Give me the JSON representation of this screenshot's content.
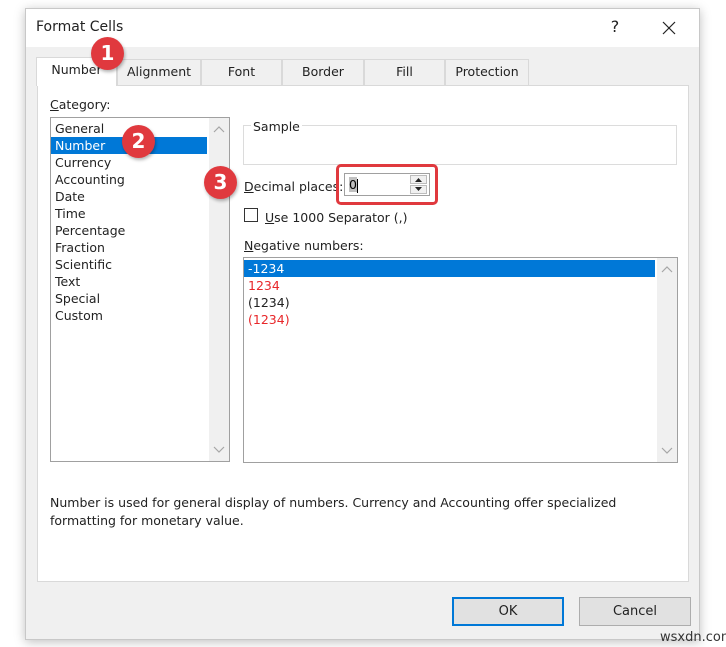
{
  "dialog": {
    "title": "Format Cells",
    "help_label": "?",
    "close_icon": "close-icon"
  },
  "tabs": [
    {
      "label": "Number",
      "active": true
    },
    {
      "label": "Alignment",
      "active": false
    },
    {
      "label": "Font",
      "active": false
    },
    {
      "label": "Border",
      "active": false
    },
    {
      "label": "Fill",
      "active": false
    },
    {
      "label": "Protection",
      "active": false
    }
  ],
  "category": {
    "label_prefix": "C",
    "label_rest": "ategory:",
    "items": [
      "General",
      "Number",
      "Currency",
      "Accounting",
      "Date",
      "Time",
      "Percentage",
      "Fraction",
      "Scientific",
      "Text",
      "Special",
      "Custom"
    ],
    "selected": "Number"
  },
  "sample": {
    "label": "Sample",
    "value": ""
  },
  "decimal_places": {
    "label_prefix": "D",
    "label_rest": "ecimal places:",
    "value": "0"
  },
  "thousand_separator": {
    "label_prefix": "U",
    "label_rest": "se 1000 Separator (,)",
    "checked": false
  },
  "negative_numbers": {
    "label_prefix": "N",
    "label_rest": "egative numbers:",
    "items": [
      {
        "text": "-1234",
        "color": "#000000",
        "selected": true
      },
      {
        "text": "1234",
        "color": "#e8272a",
        "selected": false
      },
      {
        "text": "(1234)",
        "color": "#000000",
        "selected": false
      },
      {
        "text": "(1234)",
        "color": "#e8272a",
        "selected": false
      }
    ]
  },
  "description": "Number is used for general display of numbers.  Currency and Accounting offer specialized formatting for monetary value.",
  "buttons": {
    "ok_label": "OK",
    "cancel_label": "Cancel"
  },
  "annotations": [
    "1",
    "2",
    "3"
  ],
  "watermark": "wsxdn.com",
  "colors": {
    "accent": "#0078d7",
    "annotation_red": "#e0393e",
    "negative_red": "#e8272a"
  }
}
